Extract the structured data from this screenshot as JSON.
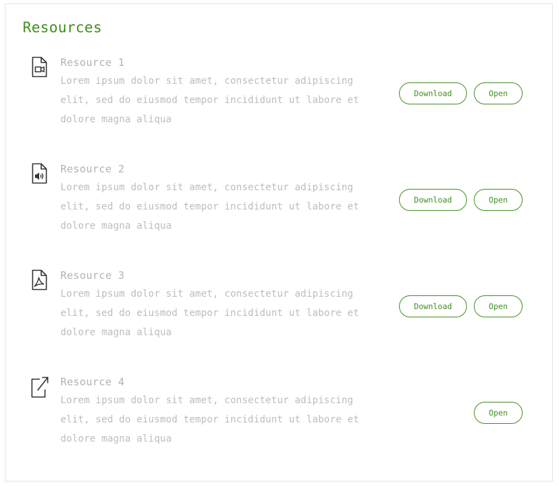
{
  "panel": {
    "title": "Resources"
  },
  "resources": [
    {
      "title": "Resource 1",
      "description": "Lorem ipsum dolor sit amet, consectetur adipiscing elit, sed do eiusmod tempor incididunt ut labore et dolore magna aliqua",
      "icon": "file-video-icon",
      "download_label": "Download",
      "open_label": "Open"
    },
    {
      "title": "Resource 2",
      "description": "Lorem ipsum dolor sit amet, consectetur adipiscing elit, sed do eiusmod tempor incididunt ut labore et dolore magna aliqua",
      "icon": "file-audio-icon",
      "download_label": "Download",
      "open_label": "Open"
    },
    {
      "title": "Resource 3",
      "description": "Lorem ipsum dolor sit amet, consectetur adipiscing elit, sed do eiusmod tempor incididunt ut labore et dolore magna aliqua",
      "icon": "file-pdf-icon",
      "download_label": "Download",
      "open_label": "Open"
    },
    {
      "title": "Resource 4",
      "description": "Lorem ipsum dolor sit amet, consectetur adipiscing elit, sed do eiusmod tempor incididunt ut labore et dolore magna aliqua",
      "icon": "external-link-icon",
      "open_label": "Open"
    }
  ],
  "colors": {
    "accent": "#3f8f1f",
    "title_text": "#b3b3b3",
    "body_text": "#bdbdbd",
    "icon": "#333333",
    "border": "#e3e3e3"
  }
}
